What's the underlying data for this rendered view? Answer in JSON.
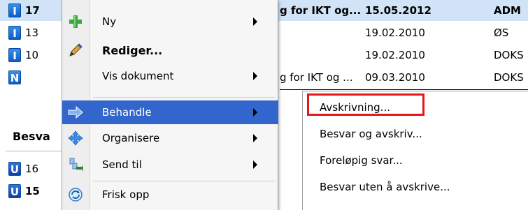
{
  "list_rows": [
    {
      "type": "I",
      "number": "17",
      "title": "g for IKT og...",
      "date": "15.05.2012",
      "owner": "ADM",
      "bold": true,
      "selected": true
    },
    {
      "type": "I",
      "number": "13",
      "title": "",
      "date": "19.02.2010",
      "owner": "ØS",
      "bold": false,
      "selected": false
    },
    {
      "type": "I",
      "number": "10",
      "title": "",
      "date": "19.02.2010",
      "owner": "DOKS",
      "bold": false,
      "selected": false
    },
    {
      "type": "N",
      "number": "",
      "title": "g for IKT og ...",
      "date": "09.03.2010",
      "owner": "DOKS",
      "bold": false,
      "selected": false
    }
  ],
  "section": {
    "title": "Besva"
  },
  "lower_rows": [
    {
      "type": "U",
      "number": "16",
      "bold": false
    },
    {
      "type": "U",
      "number": "15",
      "bold": true
    }
  ],
  "context_menu": {
    "items": [
      {
        "label": "Ny",
        "icon": "plus-icon",
        "has_submenu": true,
        "bold": false
      },
      {
        "label": "Rediger...",
        "icon": "pencil-icon",
        "has_submenu": false,
        "bold": true
      },
      {
        "label": "Vis dokument",
        "icon": "",
        "has_submenu": true,
        "bold": false
      },
      {
        "label": "Behandle",
        "icon": "process-arrow-icon",
        "has_submenu": true,
        "bold": false,
        "active": true
      },
      {
        "label": "Organisere",
        "icon": "move-arrows-icon",
        "has_submenu": true,
        "bold": false
      },
      {
        "label": "Send til",
        "icon": "send-to-icon",
        "has_submenu": true,
        "bold": false
      },
      {
        "label": "Frisk opp",
        "icon": "refresh-icon",
        "has_submenu": false,
        "bold": false
      }
    ]
  },
  "submenu": {
    "items": [
      {
        "label": "Avskrivning...",
        "highlighted": true
      },
      {
        "label": "Besvar og avskriv..."
      },
      {
        "label": "Foreløpig svar..."
      },
      {
        "label": "Besvar uten å avskrive..."
      }
    ]
  },
  "colors": {
    "selection": "#d0e3f7",
    "menu_hover": "#3366cc",
    "highlight_box": "#e21818",
    "badge_blue": "#0b5fc6"
  }
}
